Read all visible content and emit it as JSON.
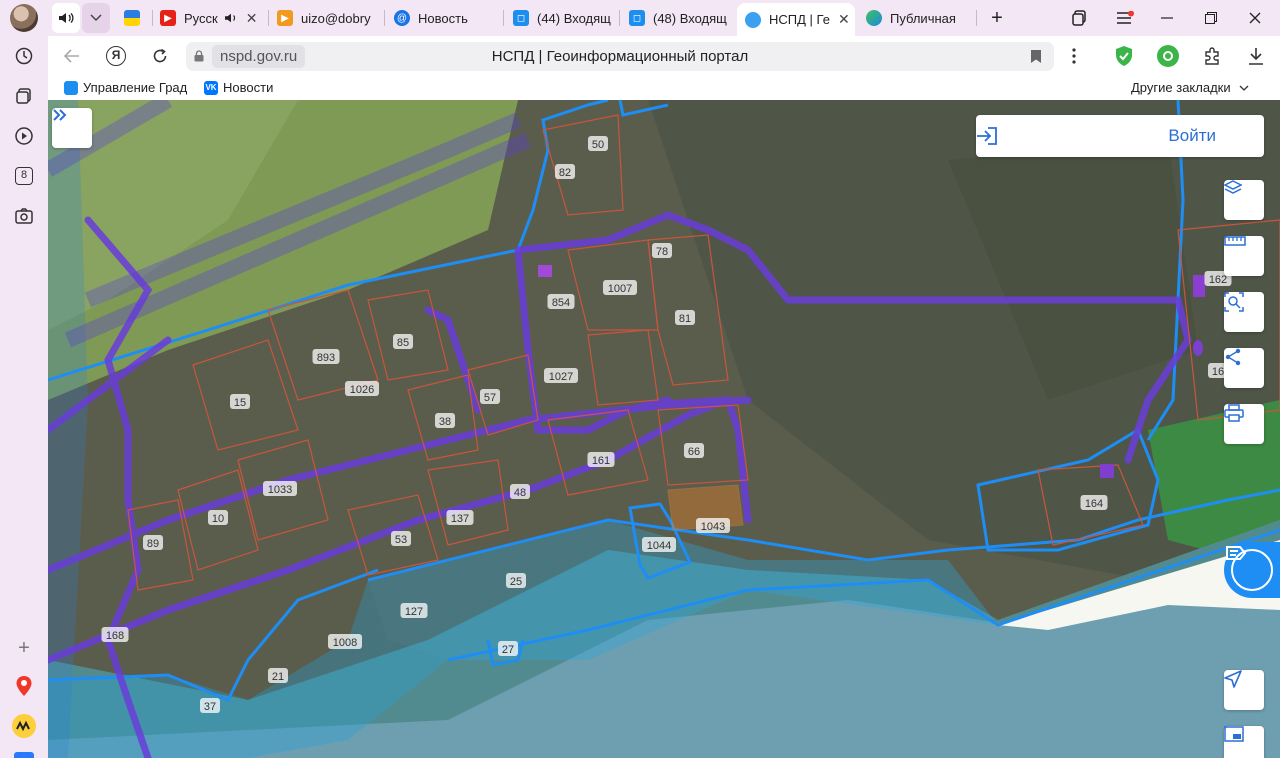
{
  "tabs": [
    {
      "title": "Русск",
      "has_close": true
    },
    {
      "title": "uizo@dobry",
      "has_close": false
    },
    {
      "title": "Новость",
      "has_close": false
    },
    {
      "title": "(44) Входящ",
      "has_close": false
    },
    {
      "title": "(48) Входящ",
      "has_close": false
    },
    {
      "title": "НСПД | Ге",
      "has_close": true,
      "active": true
    },
    {
      "title": "Публичная",
      "has_close": false
    }
  ],
  "address": {
    "domain": "nspd.gov.ru",
    "page_title": "НСПД | Геоинформационный портал"
  },
  "sidebar": {
    "badge_8": "8"
  },
  "bookmarks": {
    "items": [
      "Управление Град",
      "Новости"
    ],
    "other": "Другие закладки"
  },
  "map": {
    "login_label": "Войти",
    "plot_labels": [
      "50",
      "82",
      "78",
      "1007",
      "854",
      "81",
      "893",
      "85",
      "1026",
      "15",
      "1027",
      "57",
      "38",
      "161",
      "66",
      "48",
      "1033",
      "10",
      "137",
      "53",
      "89",
      "1043",
      "1044",
      "25",
      "127",
      "1008",
      "27",
      "168",
      "21",
      "37",
      "162",
      "16",
      "164"
    ]
  },
  "colors": {
    "zone_blue": "#1e8ef5",
    "zone_purple": "#6a3ddb",
    "water": "#6e9fb0",
    "accent": "#2b6fd6"
  }
}
